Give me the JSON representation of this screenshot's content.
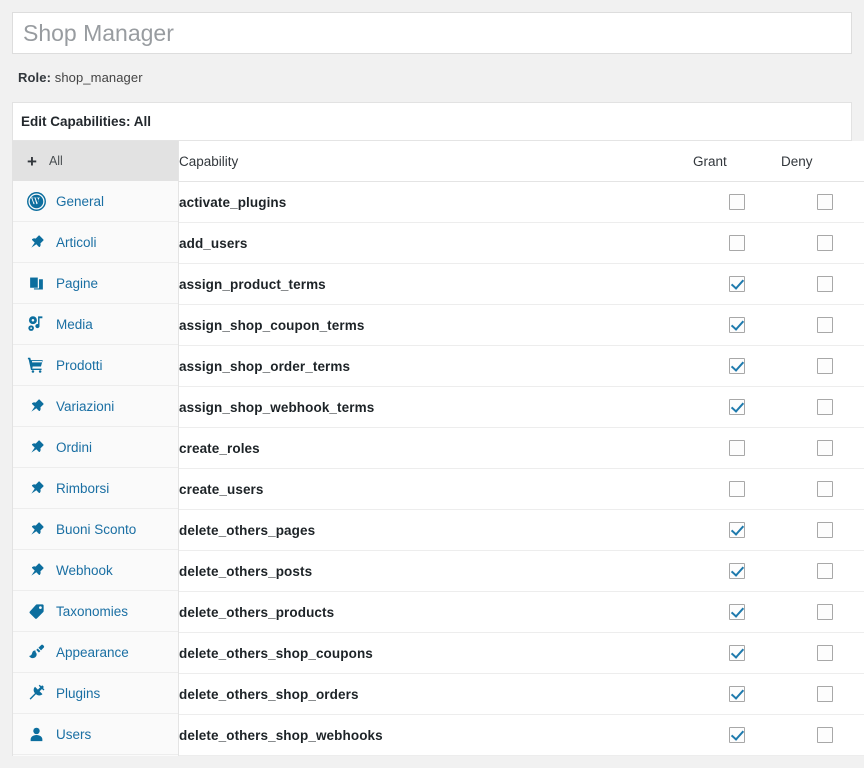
{
  "role_title": {
    "value": "Shop Manager",
    "placeholder": "Shop Manager"
  },
  "role_line": {
    "label": "Role:",
    "value": "shop_manager"
  },
  "panel": {
    "heading": "Edit Capabilities: All"
  },
  "sidebar": {
    "header": {
      "plus": "+",
      "label": "All"
    },
    "items": [
      {
        "label": "General",
        "icon": "wordpress-icon"
      },
      {
        "label": "Articoli",
        "icon": "pin-icon"
      },
      {
        "label": "Pagine",
        "icon": "pages-icon"
      },
      {
        "label": "Media",
        "icon": "media-icon"
      },
      {
        "label": "Prodotti",
        "icon": "cart-icon"
      },
      {
        "label": "Variazioni",
        "icon": "pin-icon"
      },
      {
        "label": "Ordini",
        "icon": "pin-icon"
      },
      {
        "label": "Rimborsi",
        "icon": "pin-icon"
      },
      {
        "label": "Buoni Sconto",
        "icon": "pin-icon"
      },
      {
        "label": "Webhook",
        "icon": "pin-icon"
      },
      {
        "label": "Taxonomies",
        "icon": "tag-icon"
      },
      {
        "label": "Appearance",
        "icon": "brush-icon"
      },
      {
        "label": "Plugins",
        "icon": "plug-icon"
      },
      {
        "label": "Users",
        "icon": "user-icon"
      }
    ]
  },
  "table": {
    "columns": [
      "Capability",
      "Grant",
      "Deny"
    ],
    "rows": [
      {
        "capability": "activate_plugins",
        "grant": false,
        "deny": false
      },
      {
        "capability": "add_users",
        "grant": false,
        "deny": false
      },
      {
        "capability": "assign_product_terms",
        "grant": true,
        "deny": false
      },
      {
        "capability": "assign_shop_coupon_terms",
        "grant": true,
        "deny": false
      },
      {
        "capability": "assign_shop_order_terms",
        "grant": true,
        "deny": false
      },
      {
        "capability": "assign_shop_webhook_terms",
        "grant": true,
        "deny": false
      },
      {
        "capability": "create_roles",
        "grant": false,
        "deny": false
      },
      {
        "capability": "create_users",
        "grant": false,
        "deny": false
      },
      {
        "capability": "delete_others_pages",
        "grant": true,
        "deny": false
      },
      {
        "capability": "delete_others_posts",
        "grant": true,
        "deny": false
      },
      {
        "capability": "delete_others_products",
        "grant": true,
        "deny": false
      },
      {
        "capability": "delete_others_shop_coupons",
        "grant": true,
        "deny": false
      },
      {
        "capability": "delete_others_shop_orders",
        "grant": true,
        "deny": false
      },
      {
        "capability": "delete_others_shop_webhooks",
        "grant": true,
        "deny": false
      }
    ]
  },
  "colors": {
    "link": "#1a6fa3",
    "icon": "#0c6e9e",
    "check": "#1e7aad",
    "page_bg": "#f1f1f1",
    "sidebar_bg": "#fafafa",
    "header_bg": "#e2e2e2"
  }
}
